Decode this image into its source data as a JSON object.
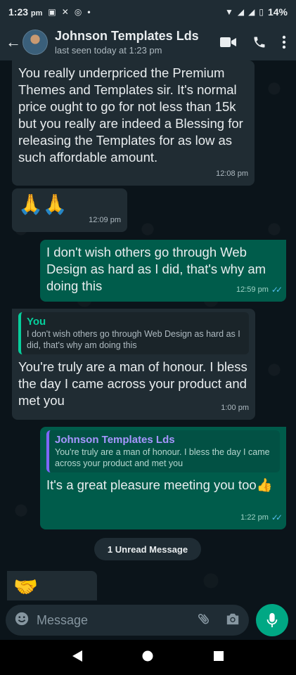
{
  "status_bar": {
    "time": "1:23",
    "ampm": "pm",
    "battery": "14%"
  },
  "header": {
    "contact_name": "Johnson Templates Lds",
    "last_seen": "last seen today at 1:23 pm"
  },
  "messages": [
    {
      "direction": "in",
      "text": "You really underpriced the Premium Themes and Templates sir. It's normal price ought to go for not less than 15k but you really are indeed a Blessing for releasing the Templates for as low as such affordable amount.",
      "time": "12:08 pm"
    },
    {
      "direction": "in",
      "text": "🙏🙏",
      "time": "12:09 pm"
    },
    {
      "direction": "out",
      "text": "I don't wish others go through Web Design as hard as I did, that's why am doing this",
      "time": "12:59 pm"
    },
    {
      "direction": "in",
      "quote_title": "You",
      "quote_text": "I don't wish others go through Web Design as hard as I did, that's why am doing this",
      "text": "You're truly are a man of honour. I bless the day I came across your product and met you",
      "time": "1:00 pm"
    },
    {
      "direction": "out",
      "quote_title": "Johnson Templates Lds",
      "quote_text": "You're truly are a man of honour. I bless the day I came across your product and met you",
      "text": "It's a great pleasure meeting you too👍",
      "time": "1:22 pm"
    },
    {
      "direction": "in",
      "text": "🤝"
    }
  ],
  "unread_label": "1 Unread Message",
  "input": {
    "placeholder": "Message"
  },
  "colors": {
    "header_bg": "#1f2c34",
    "chat_bg": "#0b141a",
    "incoming_bubble": "#202c33",
    "outgoing_bubble": "#005c4b",
    "accent": "#00a884",
    "read_ticks": "#53bdeb"
  },
  "icons": {
    "back": "arrow-left-icon",
    "video": "video-call-icon",
    "call": "phone-icon",
    "menu": "more-vertical-icon",
    "emoji": "emoji-icon",
    "attach": "paperclip-icon",
    "camera": "camera-icon",
    "mic": "microphone-icon"
  }
}
